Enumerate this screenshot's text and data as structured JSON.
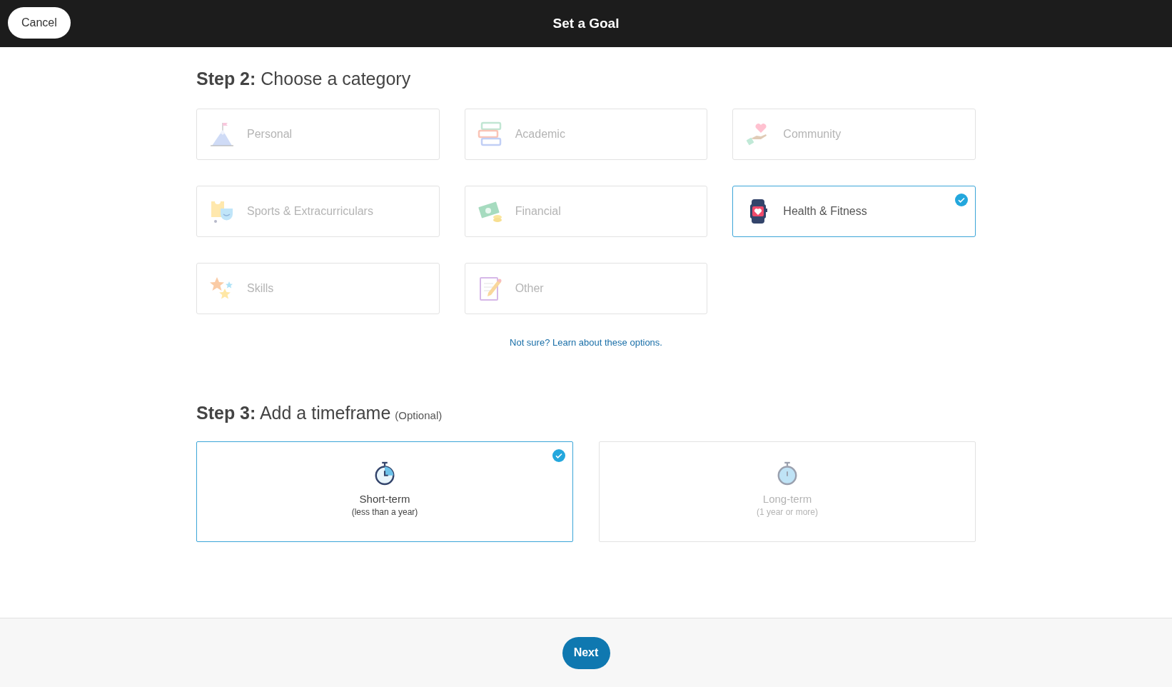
{
  "header": {
    "cancel_button": "Cancel",
    "title": "Set a Goal"
  },
  "category_step": {
    "heading": "**Step 2:** Choose a category",
    "categories": [
      {
        "label": "Personal",
        "kind": "mountain",
        "selected": false
      },
      {
        "label": "Academic",
        "kind": "books",
        "selected": false
      },
      {
        "label": "Community",
        "kind": "heart",
        "selected": false
      },
      {
        "label": "Sports & Extracurriculars",
        "kind": "sports",
        "selected": false
      },
      {
        "label": "Financial",
        "kind": "money",
        "selected": false
      },
      {
        "label": "Health & Fitness",
        "kind": "watch",
        "selected": true
      },
      {
        "label": "Skills",
        "kind": "stars",
        "selected": false
      },
      {
        "label": "Other",
        "kind": "notepad",
        "selected": false
      }
    ],
    "help_link": "Not sure? Learn about these options."
  },
  "timeframe_step": {
    "heading": "**Step 3:** Add a timeframe",
    "note": "(Optional)",
    "options": [
      {
        "title": "Short-term",
        "subtitle": "(less than a year)",
        "selected": true
      },
      {
        "title": "Long-term",
        "subtitle": "(1 year or more)",
        "selected": false
      }
    ]
  },
  "footer": {
    "next_button": "Next"
  }
}
